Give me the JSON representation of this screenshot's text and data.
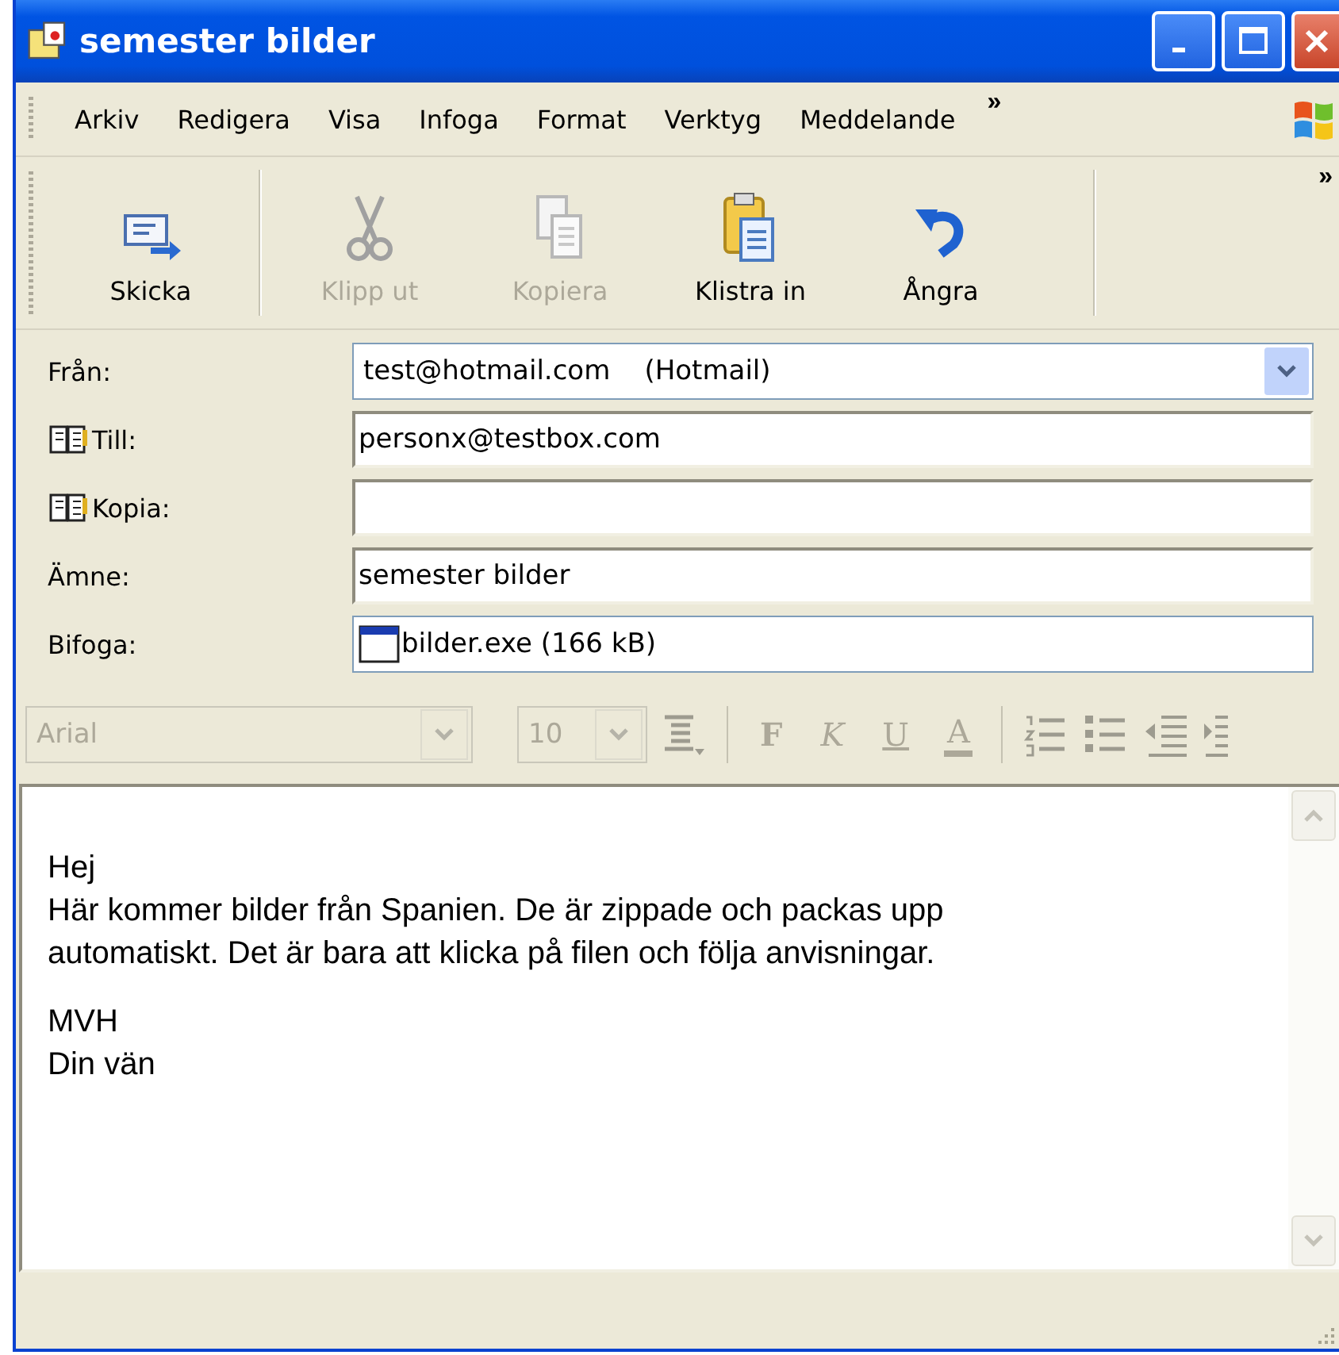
{
  "window": {
    "title": "semester bilder"
  },
  "menu": [
    "Arkiv",
    "Redigera",
    "Visa",
    "Infoga",
    "Format",
    "Verktyg",
    "Meddelande"
  ],
  "menu_overflow": "»",
  "toolbar": [
    {
      "label": "Skicka",
      "kind": "send",
      "disabled": false
    },
    {
      "label": "Klipp ut",
      "kind": "cut",
      "disabled": true
    },
    {
      "label": "Kopiera",
      "kind": "copy",
      "disabled": true
    },
    {
      "label": "Klistra in",
      "kind": "paste",
      "disabled": false
    },
    {
      "label": "Ångra",
      "kind": "undo",
      "disabled": false
    }
  ],
  "toolbar_overflow": "»",
  "fields": [
    {
      "label": "Från:",
      "kind": "select",
      "value": "test@hotmail.com    (Hotmail)"
    },
    {
      "label": "Till:",
      "kind": "address",
      "value": "personx@testbox.com"
    },
    {
      "label": "Kopia:",
      "kind": "address"
    },
    {
      "label": "Ämne:",
      "kind": "text",
      "value": "semester bilder"
    },
    {
      "label": "Bifoga:",
      "kind": "attachment",
      "value": "bilder.exe (166 kB)"
    }
  ],
  "format_toolbar": {
    "disabled": true,
    "font": "Arial",
    "size": "10",
    "styles": [
      "F",
      "K",
      "U",
      "A"
    ]
  },
  "body": [
    [
      "Hej",
      "Här kommer bilder från Spanien. De är zippade och packas upp",
      "automatiskt. Det är bara att klicka på filen och följa anvisningar."
    ],
    [
      "MVH",
      "Din vän"
    ]
  ]
}
